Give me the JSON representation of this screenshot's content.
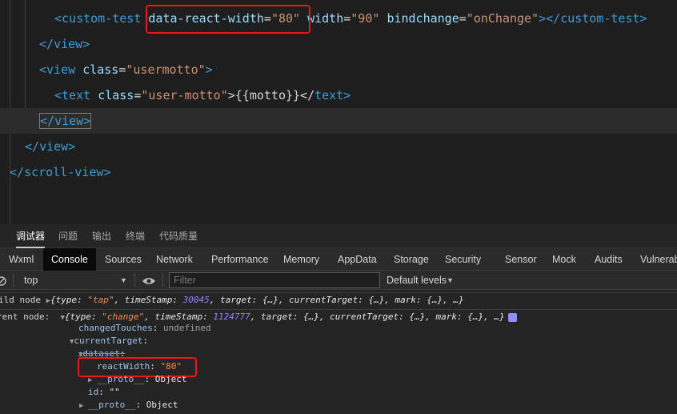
{
  "editor": {
    "lines": {
      "l1": {
        "open": "<",
        "tag": "custom-test",
        "attr1": "data-react-width",
        "eq": "=",
        "val1": "\"80\"",
        "attr2": "width",
        "val2": "\"90\"",
        "attr3": "bindchange",
        "val3": "\"onChange\"",
        "close1": "></",
        "tag2": "custom-test",
        "close2": ">"
      },
      "l2": {
        "open": "</",
        "tag": "view",
        "close": ">"
      },
      "l3": {
        "open": "<",
        "tag": "view",
        "attr": "class",
        "eq": "=",
        "val": "\"usermotto\"",
        "close": ">"
      },
      "l4": {
        "open": "<",
        "tag": "text",
        "attr": "class",
        "eq": "=",
        "val": "\"user-motto\"",
        "mid": ">{{motto}}</",
        "tag2": "text",
        "close": ">"
      },
      "l5": {
        "open": "</",
        "tag": "view",
        "close": ">"
      },
      "l6": {
        "open": "</",
        "tag": "view",
        "close": ">"
      },
      "l7": {
        "open": "</",
        "tag": "scroll-view",
        "close": ">"
      }
    }
  },
  "devtools": {
    "panel_tabs": [
      "调试器",
      "问题",
      "输出",
      "终端",
      "代码质量"
    ],
    "tool_tabs": [
      "Wxml",
      "Console",
      "Sources",
      "Network",
      "Performance",
      "Memory",
      "AppData",
      "Storage",
      "Security",
      "Sensor",
      "Mock",
      "Audits",
      "Vulnerab"
    ],
    "active_tool_tab": "Console",
    "toolbar": {
      "context": "top",
      "filter_placeholder": "Filter",
      "levels": "Default levels"
    },
    "console": {
      "row1": {
        "prefix": "ild node",
        "obj": "{type: \"tap\", timeStamp: 30045, target: {…}, currentTarget: {…}, mark: {…}, …}",
        "type_key": "type",
        "type_val": "\"tap\"",
        "ts_key": "timeStamp",
        "ts_val": "30045",
        "rest": ", target: {…}, currentTarget: {…}, mark: {…}, …}"
      },
      "row2": {
        "prefix": "rent node:",
        "type_key": "type",
        "type_val": "\"change\"",
        "ts_key": "timeStamp",
        "ts_val": "1124777",
        "rest": ", target: {…}, currentTarget: {…}, mark: {…}, …}"
      },
      "changedTouches": {
        "key": "changedTouches",
        "val": "undefined"
      },
      "currentTarget": {
        "key": "currentTarget"
      },
      "dataset": {
        "key": "dataset"
      },
      "reactWidth": {
        "key": "reactWidth",
        "val": "\"80\""
      },
      "proto1": {
        "key": "__proto__",
        "val": "Object"
      },
      "id": {
        "key": "id",
        "val": "\"\""
      },
      "proto2": {
        "key": "__proto__",
        "val": "Object"
      }
    }
  },
  "colors": {
    "highlight_box": "#e8191d",
    "tag": "#3d9cd9",
    "string": "#ce9178",
    "attribute": "#9cdcfe"
  }
}
